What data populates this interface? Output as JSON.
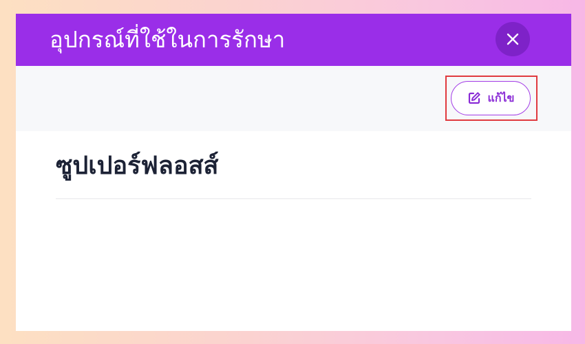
{
  "modal": {
    "title": "อุปกรณ์ที่ใช้ในการรักษา",
    "close_icon": "close-icon"
  },
  "toolbar": {
    "edit_label": "แก้ไข",
    "edit_icon": "edit-icon"
  },
  "content": {
    "item_title": "ซูปเปอร์ฟลอสส์"
  },
  "colors": {
    "header": "#9a2ee8",
    "close_button": "#7e22c8",
    "accent": "#8a2bd6",
    "highlight": "#e0393e"
  }
}
